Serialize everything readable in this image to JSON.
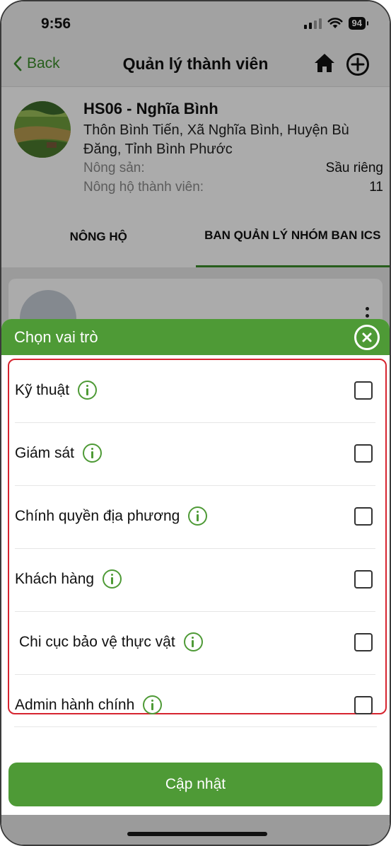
{
  "status_bar": {
    "time": "9:56",
    "battery": "94"
  },
  "nav": {
    "back_label": "Back",
    "title": "Quản lý thành viên"
  },
  "farm": {
    "name": "HS06 - Nghĩa Bình",
    "address": "Thôn Bình Tiến, Xã Nghĩa Bình, Huyện Bù Đăng, Tỉnh Bình Phước",
    "product_label": "Nông sản:",
    "product_value": "Sầu riêng",
    "members_label": "Nông hộ thành viên:",
    "members_value": "11"
  },
  "tabs": [
    {
      "label": "NÔNG HỘ",
      "active": false
    },
    {
      "label": "BAN QUẢN LÝ NHÓM BAN ICS",
      "active": true
    }
  ],
  "sheet": {
    "title": "Chọn vai trò",
    "roles": [
      {
        "label": "Kỹ thuật",
        "checked": false
      },
      {
        "label": "Giám sát",
        "checked": false
      },
      {
        "label": "Chính quyền địa phương",
        "checked": false
      },
      {
        "label": "Khách hàng",
        "checked": false
      },
      {
        "label": "Chi cục bảo vệ thực vật",
        "checked": false
      },
      {
        "label": "Admin hành chính",
        "checked": false
      }
    ],
    "update_label": "Cập nhật"
  },
  "colors": {
    "accent": "#4e9a36",
    "highlight_border": "#d6242f"
  },
  "icons": [
    "chevron-left-icon",
    "home-icon",
    "add-circle-icon",
    "close-circle-icon",
    "info-icon",
    "more-vertical-icon"
  ]
}
